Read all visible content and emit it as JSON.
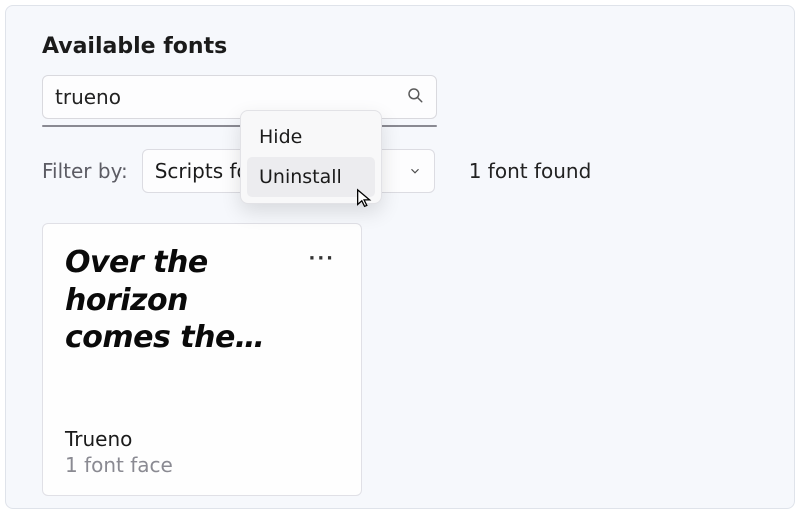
{
  "heading": "Available fonts",
  "search": {
    "value": "trueno",
    "icon": "search-icon"
  },
  "filter": {
    "label": "Filter by:",
    "selected": "Scripts for"
  },
  "result_count": "1 font found",
  "card": {
    "preview": "Over the horizon comes the…",
    "name": "Trueno",
    "faces": "1 font face"
  },
  "context_menu": {
    "items": [
      "Hide",
      "Uninstall"
    ],
    "hover_index": 1
  }
}
